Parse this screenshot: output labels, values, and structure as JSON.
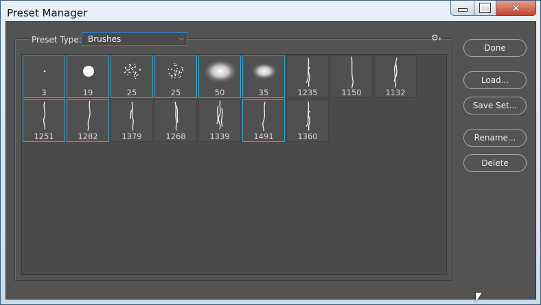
{
  "window": {
    "title": "Preset Manager"
  },
  "preset_type": {
    "label": "Preset Type:",
    "value": "Brushes"
  },
  "buttons": {
    "done": "Done",
    "load": "Load...",
    "save_set": "Save Set...",
    "rename": "Rename...",
    "delete": "Delete"
  },
  "brushes": [
    {
      "size": "3",
      "kind": "dot",
      "selected": true
    },
    {
      "size": "19",
      "kind": "hard-round",
      "selected": true
    },
    {
      "size": "25",
      "kind": "spatter",
      "selected": true
    },
    {
      "size": "25",
      "kind": "spatter",
      "selected": true
    },
    {
      "size": "50",
      "kind": "soft-round",
      "selected": true
    },
    {
      "size": "35",
      "kind": "soft-round",
      "selected": true
    },
    {
      "size": "1235",
      "kind": "hair",
      "selected": false
    },
    {
      "size": "1150",
      "kind": "hair",
      "selected": false
    },
    {
      "size": "1132",
      "kind": "hair",
      "selected": false
    },
    {
      "size": "1251",
      "kind": "hair",
      "selected": true
    },
    {
      "size": "1282",
      "kind": "hair",
      "selected": true
    },
    {
      "size": "1379",
      "kind": "hair",
      "selected": false
    },
    {
      "size": "1268",
      "kind": "hair",
      "selected": false
    },
    {
      "size": "1339",
      "kind": "hair",
      "selected": false
    },
    {
      "size": "1491",
      "kind": "hair",
      "selected": true
    },
    {
      "size": "1360",
      "kind": "hair",
      "selected": false
    }
  ]
}
